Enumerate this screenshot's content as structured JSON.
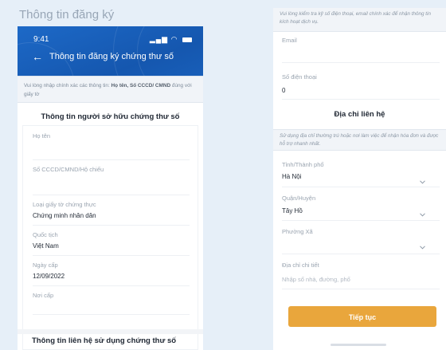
{
  "caption": "Thông tin đăng ký",
  "left": {
    "status_time": "9:41",
    "nav_title": "Thông tin đăng ký chứng thư số",
    "notice_prefix": "Vui lòng nhập chính xác các thông tin: ",
    "notice_bold": "Họ tên, Số CCCD/ CMND",
    "notice_suffix": " đúng với giấy tờ",
    "owner_section_title": "Thông tin người sở hữu chứng thư số",
    "fields": {
      "full_name_label": "Họ tên",
      "id_number_label": "Số CCCD/CMND/Hộ chiếu",
      "doc_type_label": "Loại giấy tờ chứng thực",
      "doc_type_value": "Chứng minh nhân dân",
      "nationality_label": "Quốc tịch",
      "nationality_value": "Việt Nam",
      "issue_date_label": "Ngày cấp",
      "issue_date_value": "12/09/2022",
      "issue_place_label": "Nơi cấp"
    },
    "contact_section_title": "Thông tin liên hệ sử dụng chứng thư số"
  },
  "right": {
    "notice_top": "Vui lòng kiểm tra kỹ số điện thoại, email chính xác để nhận thông tin kích hoạt dịch vụ.",
    "email_label": "Email",
    "phone_label": "Số điện thoại",
    "phone_value": "0",
    "address_title": "Địa chỉ liên hệ",
    "address_notice": "Sử dụng địa chỉ thường trú hoặc nơi làm việc để nhận hóa đơn và được hỗ trợ nhanh nhất.",
    "province_label": "Tỉnh/Thành phố",
    "province_value": "Hà Nội",
    "district_label": "Quận/Huyện",
    "district_value": "Tây Hồ",
    "ward_label": "Phường Xã",
    "detail_label": "Địa chỉ chi tiết",
    "detail_placeholder": "Nhập số nhà, đường, phố",
    "continue_button": "Tiếp tục"
  },
  "icons": {
    "back": "arrow-left-icon",
    "signal": "signal-icon",
    "wifi": "wifi-icon",
    "battery": "battery-icon",
    "dropdown": "chevron-down-icon"
  },
  "colors": {
    "header_blue": "#1a62bd",
    "accent_orange": "#e9a63c",
    "background": "#e6eff8"
  }
}
